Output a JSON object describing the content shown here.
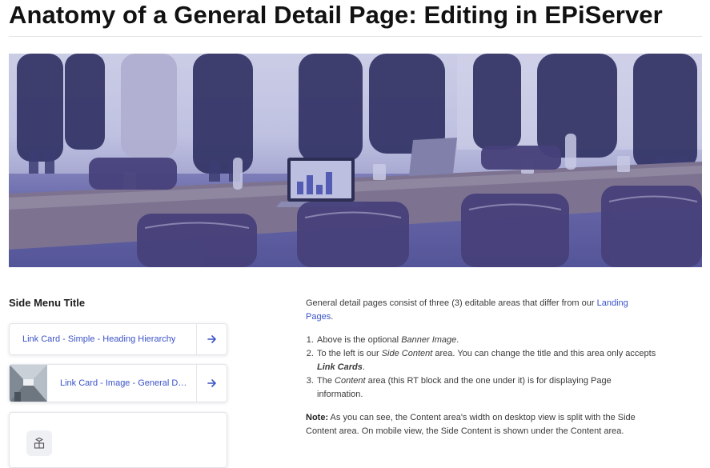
{
  "page": {
    "title": "Anatomy of a General Detail Page: Editing in EPiServer"
  },
  "side_menu": {
    "title": "Side Menu Title",
    "cards": [
      {
        "label": "Link Card - Simple - Heading Hierarchy",
        "icon": "arrow-right-icon"
      },
      {
        "label": "Link Card - Image - General Detail Page",
        "icon": "arrow-right-icon"
      },
      {
        "label": "",
        "icon": "box-icon"
      }
    ]
  },
  "content": {
    "intro_prefix": "General detail pages consist of three (3) editable areas that differ from our ",
    "intro_link": "Landing Pages",
    "intro_suffix": ".",
    "list": {
      "item1_prefix": "Above is the optional ",
      "item1_em": "Banner Image",
      "item1_suffix": ".",
      "item2_prefix": "To the left is our ",
      "item2_em": "Side Content",
      "item2_mid": " area. You can change the title and this area only accepts ",
      "item2_strong": "Link Cards",
      "item2_suffix": ".",
      "item3_prefix": "The ",
      "item3_em": "Content",
      "item3_suffix": " area (this RT block and the one under it) is for displaying Page information."
    },
    "note_label": "Note:",
    "note_text": " As you can see, the Content area's width on desktop view is split with the Side Content area. On mobile view, the Side Content is shown under the Content area."
  },
  "colors": {
    "link": "#3a53c9",
    "banner_tint": "#5a5a99"
  }
}
